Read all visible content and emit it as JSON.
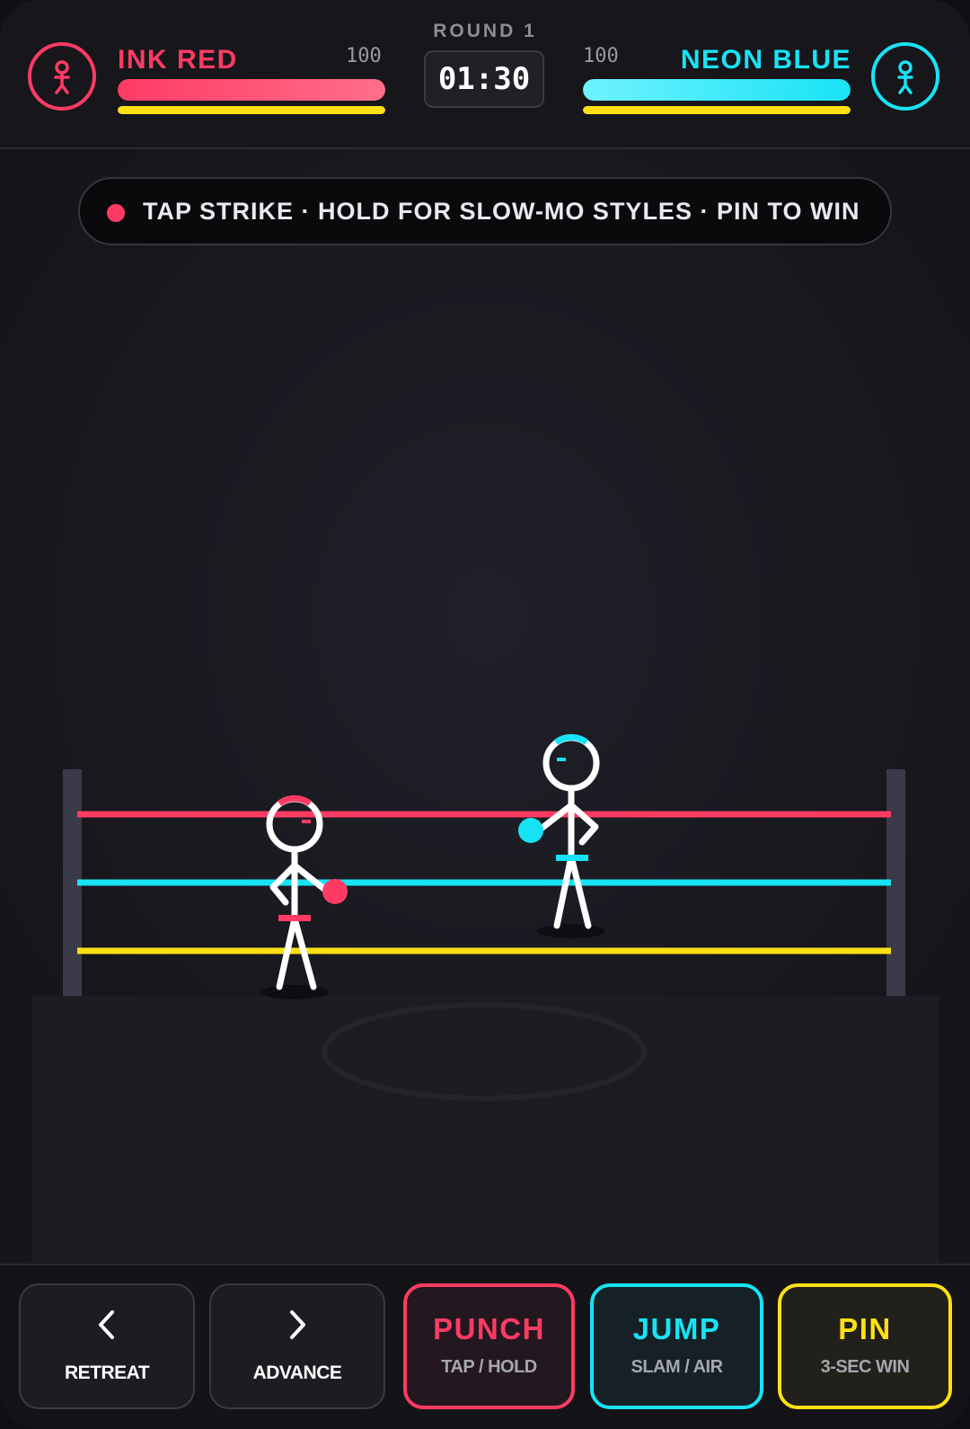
{
  "hud": {
    "round_label": "ROUND 1",
    "timer": "01:30",
    "player1": {
      "name": "INK RED",
      "hp": "100",
      "health": 1.0,
      "stamina": 1.0,
      "color": "#ff3b64",
      "icon": "stick-figure-icon"
    },
    "player2": {
      "name": "NEON BLUE",
      "hp": "100",
      "health": 1.0,
      "stamina": 1.0,
      "color": "#18e3f5",
      "icon": "stick-figure-icon"
    }
  },
  "hint": {
    "text": "TAP STRIKE · HOLD FOR SLOW-MO STYLES · PIN TO WIN",
    "dot_color": "#ff3b64"
  },
  "ring": {
    "rope_colors": [
      "#ff3b64",
      "#18e3f5",
      "#ffe014"
    ],
    "post_color": "#3b3a48"
  },
  "controls": {
    "retreat": {
      "label": "RETREAT",
      "icon": "chevron-left-icon"
    },
    "advance": {
      "label": "ADVANCE",
      "icon": "chevron-right-icon"
    },
    "punch": {
      "label": "PUNCH",
      "sub": "TAP / HOLD",
      "color": "#ff3b64"
    },
    "jump": {
      "label": "JUMP",
      "sub": "SLAM / AIR",
      "color": "#18e3f5"
    },
    "pin": {
      "label": "PIN",
      "sub": "3-SEC WIN",
      "color": "#ffe014"
    }
  }
}
